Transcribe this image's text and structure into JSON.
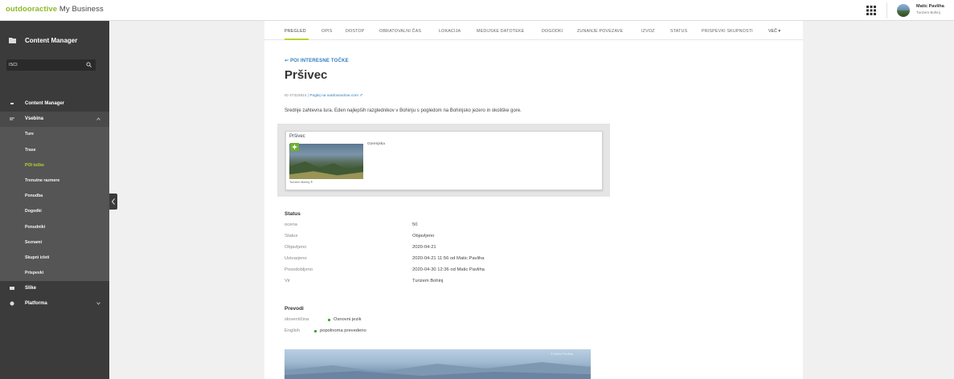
{
  "header": {
    "brand_primary": "outdooractive",
    "brand_secondary": " My Business",
    "user_name": "Matic Pavliha",
    "user_org": "Turizem Bohinj"
  },
  "sidebar": {
    "title": "Content Manager",
    "search_value": "IŠČI",
    "nav": {
      "cm": "Content Manager",
      "vsebina": "Vsebina",
      "sub": [
        "Ture",
        "Trase",
        "POI točke",
        "Trenutne razmere",
        "Ponudba",
        "Dogodki",
        "Ponudniki",
        "Seznami",
        "Skupni izleti",
        "Prispevki"
      ],
      "slike": "Slike",
      "platforma": "Platforma"
    }
  },
  "tabs": [
    "PREGLED",
    "OPIS",
    "DOSTOP",
    "OBRATOVALNI ČAS",
    "LOKACIJA",
    "MEDIJSKE DATOTEKE",
    "DOGODKI",
    "ZUNANJE POVEZAVE",
    "IZVOZ",
    "STATUS",
    "PRISPEVKI SKUPNOSTI"
  ],
  "tab_more": "VEČ ▾",
  "content": {
    "back_link": "POI INTERESNE TOČKE",
    "title": "Pršivec",
    "id_text": "ID 47323814",
    "sep": " | ",
    "view_link": "Poglej na outdooractive.com",
    "description": "Srednje zahtevna tura. Eden najlepših razglednikov v Bohinju s pogledom na Bohinjsko jezero in okoliške gore.",
    "card": {
      "title": "Pršivec",
      "region": "Gorenjska",
      "credit": "Turizem Bohinj ®"
    },
    "status": {
      "title": "Status",
      "rows": [
        {
          "k": "ocena",
          "v": "50"
        },
        {
          "k": "Status",
          "v": "Objavljeno"
        },
        {
          "k": "Objavljeno",
          "v": "2020-04-21"
        },
        {
          "k": "Ustvarjeno",
          "v": "2020-04-21 11:56 od Matic Pavliha"
        },
        {
          "k": "Posodobljeno",
          "v": "2020-04-30 12:36 od Matic Pavliha"
        },
        {
          "k": "Vir",
          "v": "Turizem Bohinj"
        }
      ]
    },
    "translations": {
      "title": "Prevodi",
      "rows": [
        {
          "lang": "slovenščina",
          "status": "Osnovni jezik"
        },
        {
          "lang": "English",
          "status": "popolnoma prevedeno"
        }
      ]
    },
    "watermark": "© Matic Pavliha"
  },
  "colors": {
    "brand_green": "#8db82a",
    "active_green": "#b8d432",
    "link_blue": "#2f7bbf",
    "sidebar_bg": "#3b3b3b",
    "status_dot": "#3fae3f"
  }
}
